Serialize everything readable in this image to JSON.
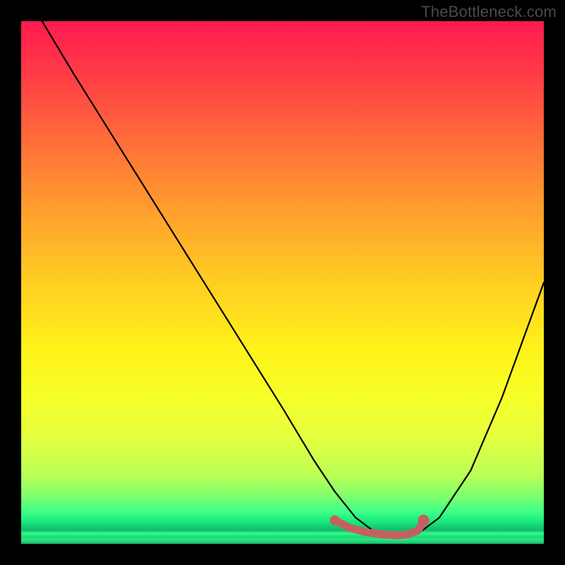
{
  "watermark": "TheBottleneck.com",
  "chart_data": {
    "type": "line",
    "title": "",
    "xlabel": "",
    "ylabel": "",
    "xlim": [
      0,
      100
    ],
    "ylim": [
      0,
      100
    ],
    "grid": false,
    "legend": false,
    "series": [
      {
        "name": "bottleneck-curve",
        "x": [
          4,
          10,
          20,
          30,
          40,
          50,
          56,
          60,
          64,
          68,
          72,
          76,
          80,
          86,
          92,
          100
        ],
        "values": [
          100,
          90,
          74,
          58,
          42,
          26,
          16,
          10,
          5,
          2,
          1,
          2,
          5,
          14,
          28,
          50
        ],
        "color": "#000000"
      },
      {
        "name": "optimal-marker",
        "x": [
          60,
          63,
          66,
          69,
          72,
          74,
          76,
          77
        ],
        "values": [
          4.5,
          3.0,
          2.2,
          1.8,
          1.6,
          1.8,
          2.6,
          4.5
        ],
        "color": "#c46060"
      }
    ],
    "annotations": []
  }
}
